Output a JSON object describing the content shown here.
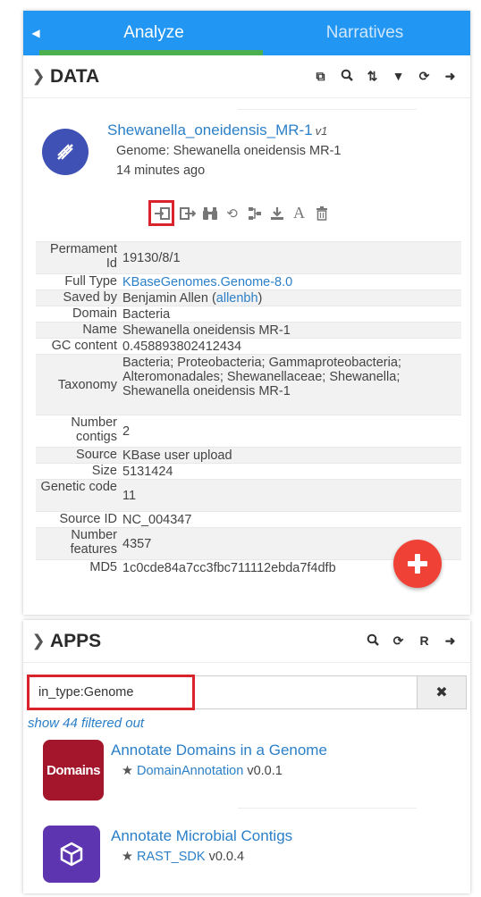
{
  "tabs": {
    "analyze": "Analyze",
    "narratives": "Narratives"
  },
  "data_panel": {
    "title": "DATA",
    "object": {
      "name": "Shewanella_oneidensis_MR-1",
      "version": "v1",
      "type_line": "Genome: Shewanella oneidensis MR-1",
      "time": "14 minutes ago"
    },
    "meta": [
      {
        "key": "Permament Id",
        "value": "19130/8/1"
      },
      {
        "key": "Full Type",
        "value": "KBaseGenomes.Genome-8.0"
      },
      {
        "key": "Saved by",
        "value": "Benjamin Allen",
        "user": "allenbh"
      },
      {
        "key": "Domain",
        "value": "Bacteria"
      },
      {
        "key": "Name",
        "value": "Shewanella oneidensis MR-1"
      },
      {
        "key": "GC content",
        "value": "0.458893802412434"
      },
      {
        "key": "Taxonomy",
        "value": "Bacteria; Proteobacteria; Gammaproteobacteria; Alteromonadales; Shewanellaceae; Shewanella; Shewanella oneidensis MR-1"
      },
      {
        "key": "Number contigs",
        "value": "2"
      },
      {
        "key": "Source",
        "value": "KBase user upload"
      },
      {
        "key": "Size",
        "value": "5131424"
      },
      {
        "key": "Genetic code",
        "value": "11"
      },
      {
        "key": "Source ID",
        "value": "NC_004347"
      },
      {
        "key": "Number features",
        "value": "4357"
      },
      {
        "key": "MD5",
        "value": "1c0cde84a7cc3fbc711112ebda7f4dfb"
      }
    ]
  },
  "apps_panel": {
    "title": "APPS",
    "search_value": "in_type:Genome",
    "filtered_text": "show 44 filtered out",
    "apps": [
      {
        "name": "Annotate Domains in a Genome",
        "logo_text": "Domains",
        "module": "DomainAnnotation",
        "version": "v0.0.1",
        "logo_color": "#a3162b"
      },
      {
        "name": "Annotate Microbial Contigs",
        "module": "RAST_SDK",
        "version": "v0.0.4",
        "logo_color": "#5e35b1"
      }
    ]
  },
  "colors": {
    "tab_bar": "#2196f3",
    "tab_underline": "#4caf50",
    "highlight": "#d9232d",
    "add_button": "#ef4136",
    "link": "#2b7fc8"
  }
}
